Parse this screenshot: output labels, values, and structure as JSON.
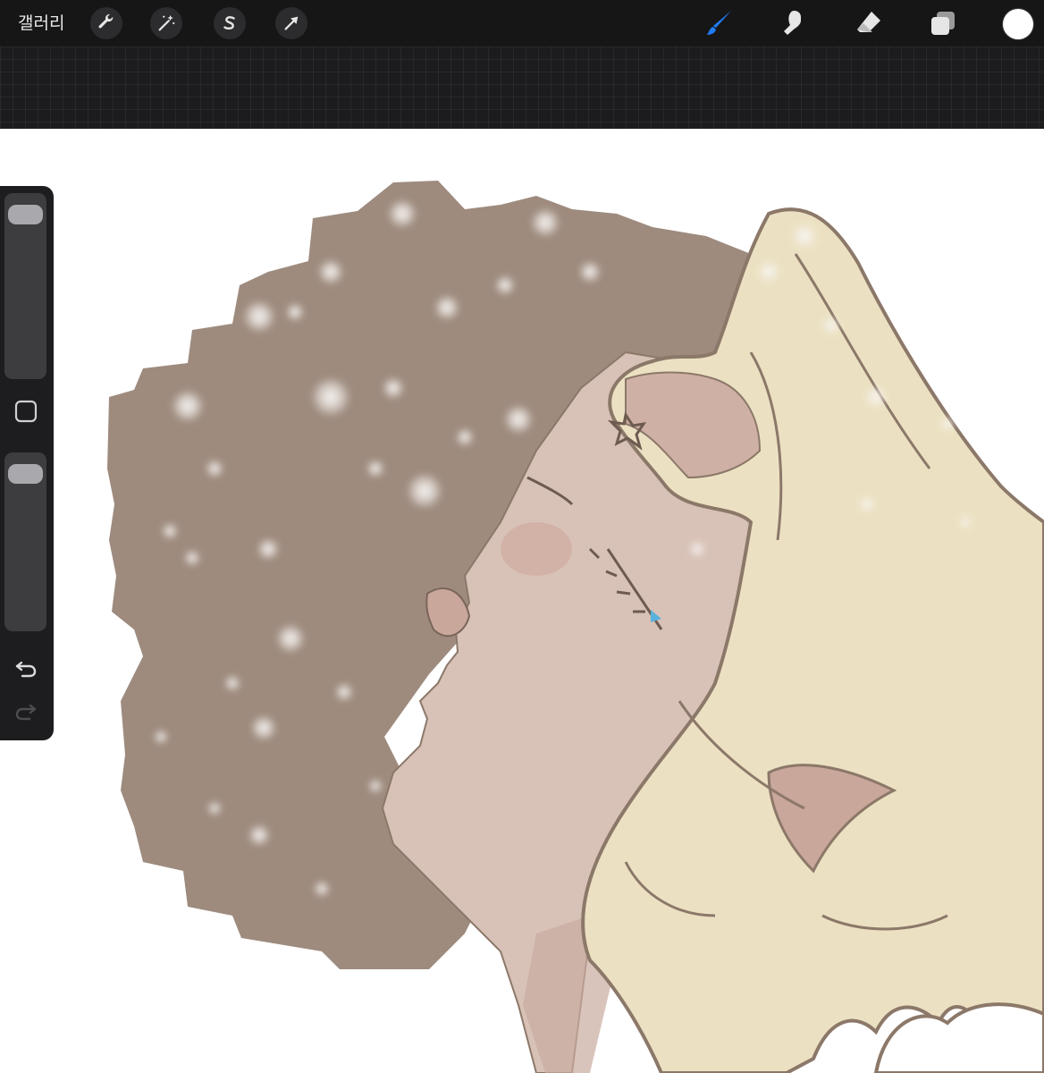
{
  "app": {
    "gallery_label": "갤러리"
  },
  "toolbar": {
    "left_tools": [
      {
        "name": "actions",
        "icon": "wrench-icon"
      },
      {
        "name": "adjustments",
        "icon": "magic-wand-icon"
      },
      {
        "name": "selection",
        "icon": "selection-s-icon"
      },
      {
        "name": "transform",
        "icon": "arrow-cursor-icon"
      }
    ],
    "right_tools": [
      {
        "name": "brush",
        "icon": "brush-icon",
        "active": true
      },
      {
        "name": "smudge",
        "icon": "smudge-finger-icon",
        "active": false
      },
      {
        "name": "eraser",
        "icon": "eraser-icon",
        "active": false
      },
      {
        "name": "layers",
        "icon": "layers-icon",
        "active": false
      }
    ],
    "current_color": "#ffffff"
  },
  "colors": {
    "toolbar_bg": "#161617",
    "active_tool": "#1f7cf4",
    "icon": "#e6e6e6",
    "hair_brown": "#9e8b7e",
    "hair_blonde": "#ebe1c2",
    "skin": "#d8c2b7",
    "outline": "#8c7869"
  },
  "sidebar": {
    "brush_size_level": 0.95,
    "opacity_level": 0.95,
    "modify_button_icon": "square-modify-icon",
    "undo_icon": "undo-icon",
    "redo_icon": "redo-icon",
    "redo_enabled": false
  }
}
